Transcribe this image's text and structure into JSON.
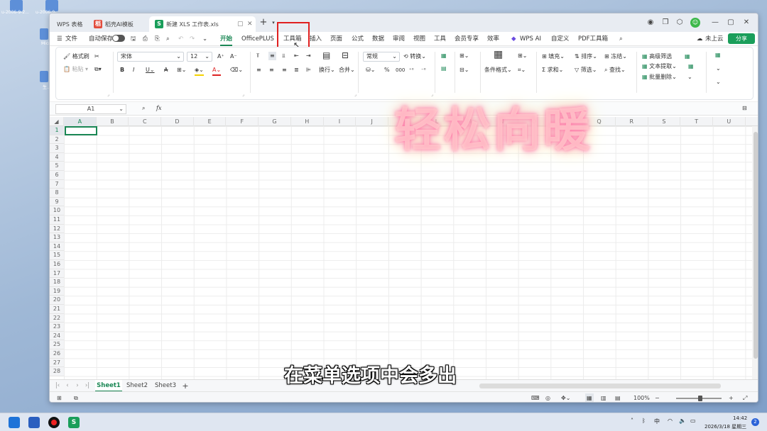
{
  "desktop": {
    "icon1": "u-2006-9-2...",
    "icon2": "u-2006-9-...",
    "icon3": "Micr E...",
    "icon4": "生..."
  },
  "tabs": [
    {
      "label": "WPS 表格"
    },
    {
      "label": "稻壳AI模板"
    },
    {
      "label": "新建 XLS 工作表.xls"
    }
  ],
  "menu": {
    "file": "文件",
    "autosave": "自动保存",
    "items": [
      "开始",
      "OfficePLUS",
      "工具箱",
      "插入",
      "页面",
      "公式",
      "数据",
      "审阅",
      "视图",
      "工具",
      "会员专享",
      "效率",
      "WPS AI",
      "自定义",
      "PDF工具箱"
    ],
    "cloud": "未上云",
    "share": "分享"
  },
  "ribbon": {
    "format_painter": "格式刷",
    "paste": "粘贴",
    "font_name": "宋体",
    "font_size": "12",
    "wrap": "换行",
    "merge": "合并",
    "number_format": "常规",
    "convert": "转换",
    "conditional": "条件格式",
    "fill": "填充",
    "sort": "排序",
    "freeze": "冻结",
    "sum": "求和",
    "filter": "筛选",
    "find": "查找",
    "adv_filter": "高级筛选",
    "text_extract": "文本提取",
    "batch_delete": "批量删除"
  },
  "formula_bar": {
    "name_box": "A1",
    "fx": "fx"
  },
  "grid": {
    "columns": [
      "A",
      "B",
      "C",
      "D",
      "E",
      "F",
      "G",
      "H",
      "I",
      "J",
      "K",
      "L",
      "M",
      "N",
      "O",
      "P",
      "Q",
      "R",
      "S",
      "T",
      "U"
    ],
    "rows": [
      "1",
      "2",
      "3",
      "4",
      "5",
      "6",
      "7",
      "8",
      "9",
      "10",
      "11",
      "12",
      "13",
      "14",
      "15",
      "16",
      "17",
      "18",
      "19",
      "20",
      "21",
      "22",
      "23",
      "24",
      "25",
      "26",
      "27",
      "28"
    ]
  },
  "sheets": [
    "Sheet1",
    "Sheet2",
    "Sheet3"
  ],
  "status": {
    "zoom": "100%"
  },
  "overlay": {
    "watermark": "轻松向暖",
    "subtitle": "在菜单选项中会多出"
  },
  "taskbar": {
    "ime": "中",
    "time": "14:42",
    "date": "2026/3/18 星期三",
    "badge": "2"
  },
  "colors": {
    "accent": "#1a8754",
    "highlight": "#e02020"
  }
}
